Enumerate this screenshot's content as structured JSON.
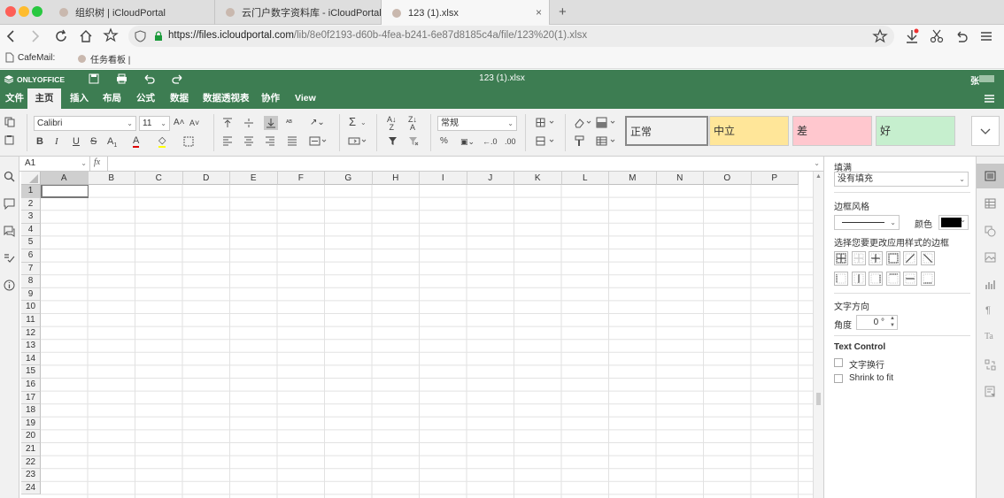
{
  "browser": {
    "tabs": [
      {
        "title": "组织树 | iCloudPortal"
      },
      {
        "title": "云门户数字资料库 - iCloudPortal"
      },
      {
        "title": "123 (1).xlsx"
      }
    ],
    "new_tab": "+",
    "close": "×",
    "url_prefix": "https://files.icloudportal.com",
    "url_rest": "/lib/8e0f2193-d60b-4fea-b241-6e87d8185c4a/file/123%20(1).xlsx",
    "bookmarks": [
      "CafeMail: ",
      "任务看板 | "
    ]
  },
  "app": {
    "logo": "ONLYOFFICE",
    "doc_title": "123 (1).xlsx",
    "user": "张"
  },
  "menu": [
    "文件",
    "主页",
    "插入",
    "布局",
    "公式",
    "数据",
    "数据透视表",
    "协作",
    "View"
  ],
  "toolbar": {
    "font_name": "Calibri",
    "font_size": "11",
    "number_format": "常规",
    "styles": [
      {
        "label": "正常",
        "bg": "#ffffff"
      },
      {
        "label": "中立",
        "bg": "#ffe699"
      },
      {
        "label": "差",
        "bg": "#ffc7ce"
      },
      {
        "label": "好",
        "bg": "#c6efce"
      }
    ]
  },
  "formula": {
    "cell_ref": "A1",
    "fx": "fx",
    "value": ""
  },
  "sheet": {
    "columns": [
      "A",
      "B",
      "C",
      "D",
      "E",
      "F",
      "G",
      "H",
      "I",
      "J",
      "K",
      "L",
      "M",
      "N",
      "O",
      "P"
    ],
    "rows": [
      "1",
      "2",
      "3",
      "4",
      "5",
      "6",
      "7",
      "8",
      "9",
      "10",
      "11",
      "12",
      "13",
      "14",
      "15",
      "16",
      "17",
      "18",
      "19",
      "20",
      "21",
      "22",
      "23",
      "24"
    ]
  },
  "panel": {
    "fill_label": "填满",
    "fill_value": "没有填充",
    "border_style_label": "边框风格",
    "color_label": "颜色",
    "border_color": "#000000",
    "border_apply_label": "选择您要更改应用样式的边框",
    "text_dir_label": "文字方向",
    "angle_label": "角度",
    "angle_value": "0 °",
    "text_control_label": "Text Control",
    "wrap_label": "文字换行",
    "shrink_label": "Shrink to fit"
  },
  "colors": {
    "brand": "#3d7d52",
    "accent_green_url": "#1a9a3a"
  }
}
